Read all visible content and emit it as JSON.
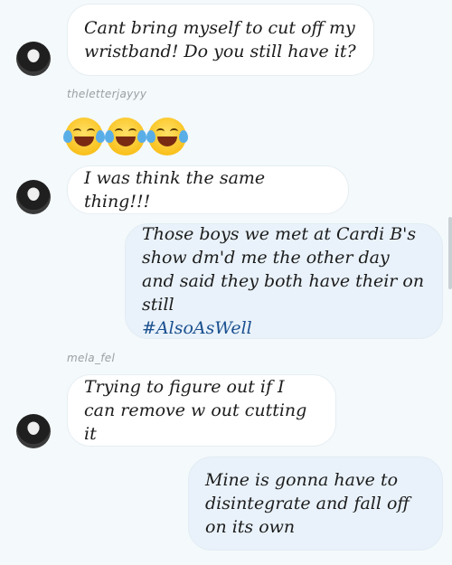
{
  "messages": [
    {
      "text": "Cant bring myself to cut off my wristband! Do you still have it?"
    },
    {
      "text": "I was think the same thing!!!"
    },
    {
      "text": "Those boys we met at Cardi B's show dm'd me the other day and said they both have their on still",
      "hashtag": "#AlsoAsWell"
    },
    {
      "text": "Trying to figure out if I can remove w out cutting it"
    },
    {
      "text": "Mine is gonna have to disintegrate and fall off on its own"
    }
  ],
  "usernames": [
    "theletterjayyy",
    "mela_fel"
  ],
  "emojis": [
    "face-with-tears-of-joy",
    "face-with-tears-of-joy",
    "face-with-tears-of-joy"
  ],
  "colors": {
    "background": "#f4f9fb",
    "incoming": "#ffffff",
    "outgoing": "#e9f2fa",
    "hashtag": "#1a4f8f"
  }
}
